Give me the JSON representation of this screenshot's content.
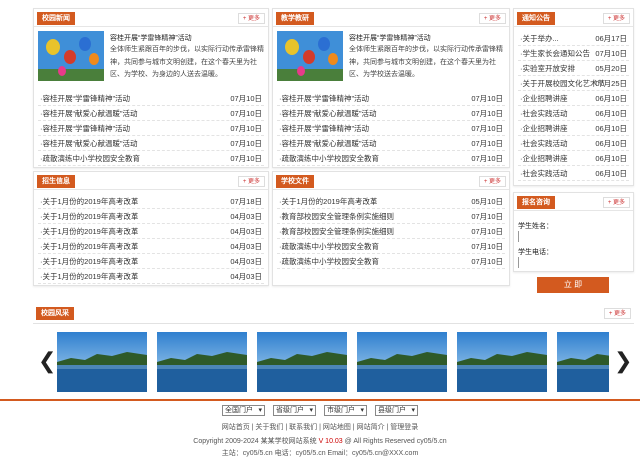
{
  "news": {
    "title": "校园新闻",
    "more": "+ 更多",
    "featured_title": "容桂开展“学雷锋精神”活动",
    "featured_desc": "全体师生紧跟百年的步伐，以实际行动传承雷锋精神，共同参与城市文明创建，在这个春天里为社区、为学校、为身边的人送去温暖。",
    "items": [
      {
        "text": "·容桂开展“学雷锋精神”活动",
        "date": "07月10日"
      },
      {
        "text": "·容桂开展“献爱心献温暖”活动",
        "date": "07月10日"
      },
      {
        "text": "·容桂开展“学雷锋精神”活动",
        "date": "07月10日"
      },
      {
        "text": "·容桂开展“献爱心献温暖”活动",
        "date": "07月10日"
      },
      {
        "text": "·疏散演练中小学校园安全教育",
        "date": "07月10日"
      }
    ]
  },
  "teaching": {
    "title": "教学教研",
    "more": "+ 更多",
    "featured_title": "容桂开展“学雷锋精神”活动",
    "featured_desc": "全体师生紧跟百年的步伐，以实际行动传承雷锋精神，共同参与城市文明创建，在这个春天里为社区、为学校送去温暖。",
    "items": [
      {
        "text": "·容桂开展“学雷锋精神”活动",
        "date": "07月10日"
      },
      {
        "text": "·容桂开展“献爱心献温暖”活动",
        "date": "07月10日"
      },
      {
        "text": "·容桂开展“学雷锋精神”活动",
        "date": "07月10日"
      },
      {
        "text": "·容桂开展“献爱心献温暖”活动",
        "date": "07月10日"
      },
      {
        "text": "·疏散演练中小学校园安全教育",
        "date": "07月10日"
      }
    ]
  },
  "notice": {
    "title": "通知公告",
    "more": "+ 更多",
    "items": [
      {
        "text": "·关于举办...",
        "date": "06月17日"
      },
      {
        "text": "·学生家长会通知公告",
        "date": "07月10日"
      },
      {
        "text": "·实验室开放安排",
        "date": "05月20日"
      },
      {
        "text": "·关于开展校园文化艺术节的通知公告",
        "date": "07月25日"
      },
      {
        "text": "·企业招聘讲座",
        "date": "06月10日"
      },
      {
        "text": "·社会实践活动",
        "date": "06月10日"
      },
      {
        "text": "·企业招聘讲座",
        "date": "06月10日"
      },
      {
        "text": "·社会实践活动",
        "date": "06月10日"
      },
      {
        "text": "·企业招聘讲座",
        "date": "06月10日"
      },
      {
        "text": "·社会实践活动",
        "date": "06月10日"
      }
    ]
  },
  "admissions": {
    "title": "招生信息",
    "more": "+ 更多",
    "items": [
      {
        "text": "·关于1月份的2019年高考改革",
        "date": "07月18日"
      },
      {
        "text": "·关于1月份的2019年高考改革",
        "date": "04月03日"
      },
      {
        "text": "·关于1月份的2019年高考改革",
        "date": "04月03日"
      },
      {
        "text": "·关于1月份的2019年高考改革",
        "date": "04月03日"
      },
      {
        "text": "·关于1月份的2019年高考改革",
        "date": "04月03日"
      },
      {
        "text": "·关于1月份的2019年高考改革",
        "date": "04月03日"
      }
    ]
  },
  "docs": {
    "title": "学校文件",
    "more": "+ 更多",
    "items": [
      {
        "text": "·关于1月份的2019年高考改革",
        "date": "05月10日"
      },
      {
        "text": "·教育部校园安全管理条例实施细则",
        "date": "07月10日"
      },
      {
        "text": "·教育部校园安全管理条例实施细则",
        "date": "07月10日"
      },
      {
        "text": "·疏散演练中小学校园安全教育",
        "date": "07月10日"
      },
      {
        "text": "·疏散演练中小学校园安全教育",
        "date": "07月10日"
      }
    ]
  },
  "signup": {
    "title": "报名咨询",
    "more": "+ 更多",
    "name_label": "学生姓名：",
    "phone_label": "学生电话：",
    "submit": "立 即"
  },
  "gallery": {
    "title": "校园风采",
    "more": "+ 更多",
    "prev": "❮",
    "next": "❯",
    "images": [
      "lake-landscape",
      "lake-landscape",
      "lake-landscape",
      "lake-landscape",
      "lake-landscape",
      "lake-landscape"
    ]
  },
  "footer": {
    "selects": [
      "全国门户",
      "省级门户",
      "市级门户",
      "县级门户"
    ],
    "links": [
      "网站首页",
      "关于我们",
      "联系我们",
      "网站地图",
      "网站简介",
      "管理登录"
    ],
    "copyright": "Copyright 2009-2024 某某学校网站系统 ",
    "version": "V 10.03",
    "copyright_tail": " @ All Rights Reserved cy05/5.cn",
    "contact": "主站：cy05/5.cn   电话：cy05/5.cn Email：cy05/5.cn@XXX.com"
  },
  "colors": {
    "accent": "#d35a1f"
  }
}
